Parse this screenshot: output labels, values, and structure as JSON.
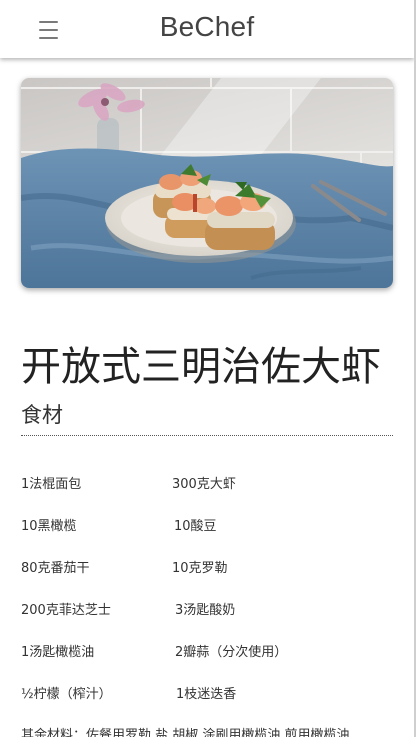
{
  "header": {
    "brand": "BeChef",
    "menu_icon": "hamburger-menu-icon"
  },
  "recipe": {
    "title": "开放式三明治佐大虾",
    "hero_image": "open-faced-shrimp-sandwich-photo",
    "ingredients_heading": "食材",
    "ingredients": [
      [
        "1法棍面包",
        "300克大虾"
      ],
      [
        "10黑橄榄",
        "10酸豆"
      ],
      [
        "80克番茄干",
        "10克罗勒"
      ],
      [
        "200克菲达芝士",
        "3汤匙酸奶"
      ],
      [
        "1汤匙橄榄油",
        "2瓣蒜（分次使用）"
      ],
      [
        "½柠檬（榨汁）",
        "1枝迷迭香"
      ]
    ],
    "other_materials": "其余材料：佐餐用罗勒,盐,胡椒,涂刷用橄榄油,煎用橄榄油"
  },
  "colors": {
    "accent_text": "#444444",
    "divider": "#555555",
    "cloth_blue": "#5f87ab"
  }
}
